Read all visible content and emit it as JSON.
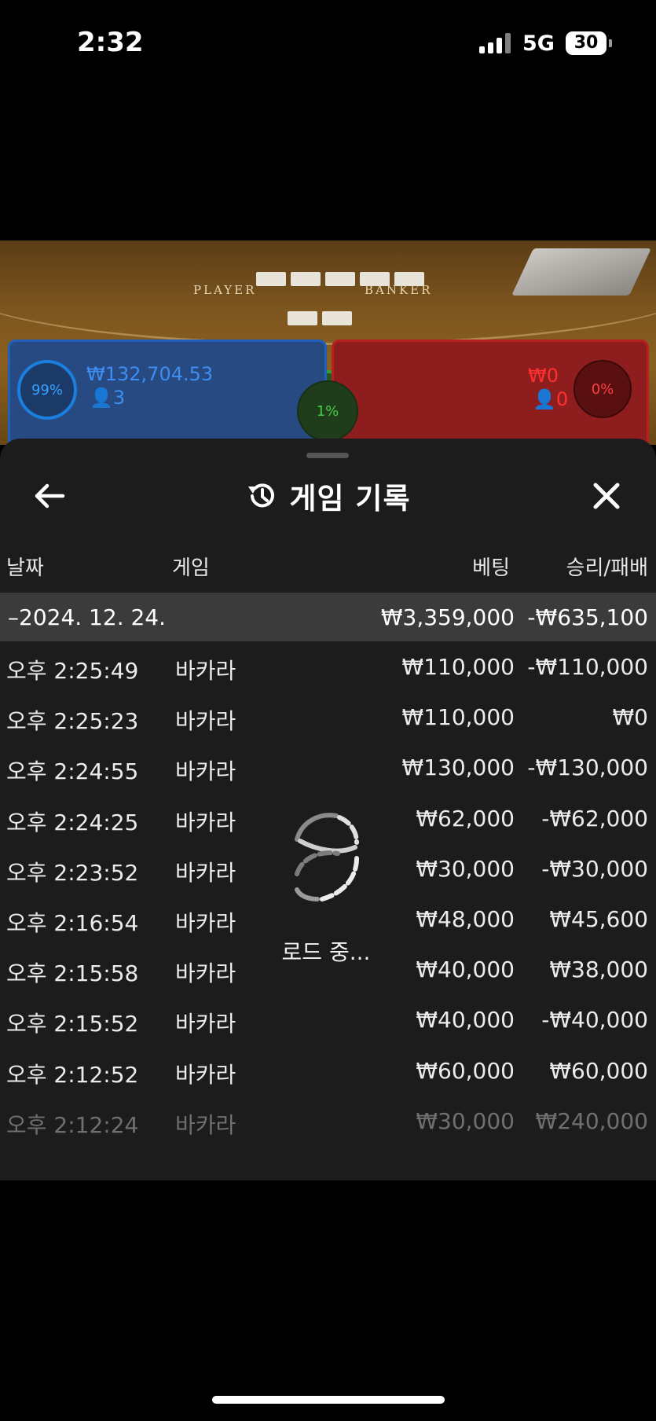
{
  "status_bar": {
    "time": "2:32",
    "network": "5G",
    "battery": "30"
  },
  "game": {
    "player_label": "PLAYER",
    "banker_label": "BANKER",
    "player": {
      "percent": "99%",
      "amount": "₩132,704.53",
      "players": "3"
    },
    "tie": {
      "percent": "1%"
    },
    "banker": {
      "percent": "0%",
      "amount": "₩0",
      "players": "0"
    }
  },
  "modal": {
    "title": "게임 기록",
    "columns": {
      "date": "날짜",
      "game": "게임",
      "bet": "베팅",
      "win_loss": "승리/패배"
    },
    "day_summary": {
      "date": "–2024. 12. 24.",
      "bet": "₩3,359,000",
      "win_loss": "-₩635,100"
    },
    "rows": [
      {
        "time": "오후 2:25:49",
        "game": "바카라",
        "bet": "₩110,000",
        "win_loss": "-₩110,000"
      },
      {
        "time": "오후 2:25:23",
        "game": "바카라",
        "bet": "₩110,000",
        "win_loss": "₩0"
      },
      {
        "time": "오후 2:24:55",
        "game": "바카라",
        "bet": "₩130,000",
        "win_loss": "-₩130,000"
      },
      {
        "time": "오후 2:24:25",
        "game": "바카라",
        "bet": "₩62,000",
        "win_loss": "-₩62,000"
      },
      {
        "time": "오후 2:23:52",
        "game": "바카라",
        "bet": "₩30,000",
        "win_loss": "-₩30,000"
      },
      {
        "time": "오후 2:16:54",
        "game": "바카라",
        "bet": "₩48,000",
        "win_loss": "₩45,600"
      },
      {
        "time": "오후 2:15:58",
        "game": "바카라",
        "bet": "₩40,000",
        "win_loss": "₩38,000"
      },
      {
        "time": "오후 2:15:52",
        "game": "바카라",
        "bet": "₩40,000",
        "win_loss": "-₩40,000"
      },
      {
        "time": "오후 2:12:52",
        "game": "바카라",
        "bet": "₩60,000",
        "win_loss": "₩60,000"
      },
      {
        "time": "오후 2:12:24",
        "game": "바카라",
        "bet": "₩30,000",
        "win_loss": "₩240,000"
      }
    ],
    "loading_text": "로드 중..."
  },
  "icons": {
    "back": "arrow-left-icon",
    "history": "history-clock-icon",
    "close": "close-icon",
    "loader": "spinner-icon"
  }
}
